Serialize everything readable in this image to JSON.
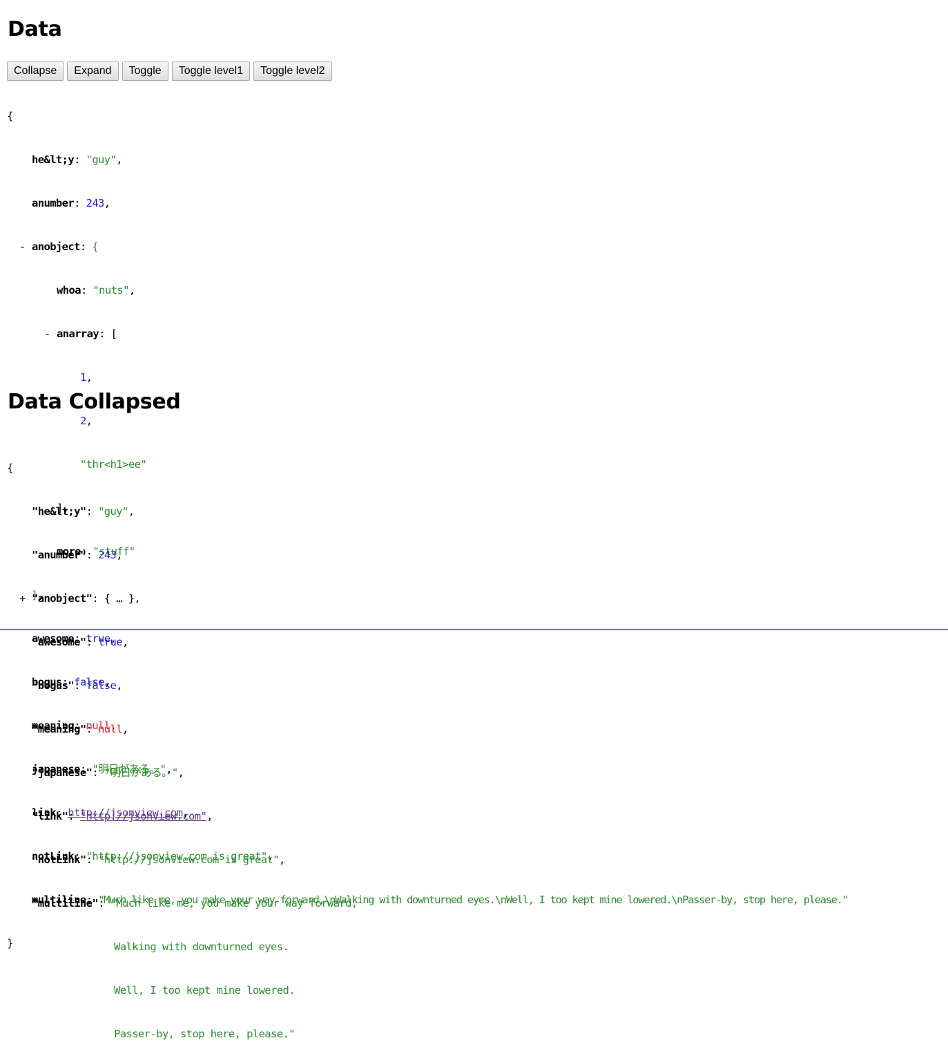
{
  "titles": {
    "data": "Data",
    "collapsed": "Data Collapsed"
  },
  "toolbar": {
    "collapse": "Collapse",
    "expand": "Expand",
    "toggle": "Toggle",
    "toggle1": "Toggle level1",
    "toggle2": "Toggle level2"
  },
  "toggles": {
    "minus": "-",
    "plus": "+"
  },
  "expanded": {
    "hely_key": "he&lt;y",
    "hely_val": "\"guy\"",
    "anumber_key": "anumber",
    "anumber_val": "243",
    "anobject_key": "anobject",
    "whoa_key": "whoa",
    "whoa_val": "\"nuts\"",
    "anarray_key": "anarray",
    "arr0": "1",
    "arr1": "2",
    "arr2": "\"thr<h1>ee\"",
    "more_key": "more",
    "more_val": "\"stuff\"",
    "awesome_key": "awesome",
    "awesome_val": "true",
    "bogus_key": "bogus",
    "bogus_val": "false",
    "meaning_key": "meaning",
    "meaning_val": "null",
    "japanese_key": "japanese",
    "japanese_val": "\"明日がある。\"",
    "link_key": "link",
    "link_val": "http://jsonview.com",
    "notlink_key": "notLink",
    "notlink_val": "\"http://jsonview.com is great\"",
    "multiline_key": "multiline",
    "multiline_val": "\"Much like me, you make your way forward,\\nWalking with downturned eyes.\\nWell, I too kept mine lowered.\\nPasser-by, stop here, please.\""
  },
  "collapsed": {
    "hely_key": "\"he&lt;y\"",
    "hely_val": "\"guy\"",
    "anumber_key": "\"anumber\"",
    "anumber_val": "243",
    "anobject_key": "\"anobject\"",
    "anobject_summary": "{ … },",
    "awesome_key": "\"awesome\"",
    "awesome_val": "true",
    "bogus_key": "\"bogus\"",
    "bogus_val": "false",
    "meaning_key": "\"meaning\"",
    "meaning_val": "null",
    "japanese_key": "\"japanese\"",
    "japanese_val": "\"明日がある。\"",
    "link_key": "\"link\"",
    "link_val": "\"http://jsonview.com\"",
    "notlink_key": "\"notLink\"",
    "notlink_val": "\"http://jsonview.com is great\"",
    "multiline_key": "\"multiline\"",
    "ml1": "\"Much like me, you make your way forward,",
    "ml2": "Walking with downturned eyes.",
    "ml3": "Well, I too kept mine lowered.",
    "ml4": "Passer-by, stop here, please.\""
  },
  "colors": {
    "string": "#2e8b2e",
    "number": "#2222cc",
    "null": "#e02020",
    "link": "#5b3a8c"
  }
}
